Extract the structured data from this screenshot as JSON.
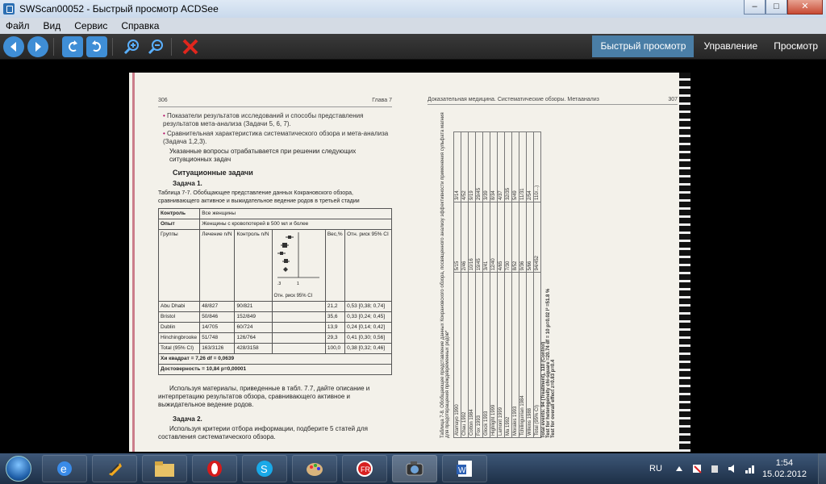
{
  "window": {
    "title": "SWScan00052 - Быстрый просмотр ACDSee"
  },
  "menu": [
    "Файл",
    "Вид",
    "Сервис",
    "Справка"
  ],
  "toolbar": {
    "buttons": [
      "back-icon",
      "forward-icon",
      "rotate-left-icon",
      "rotate-right-icon",
      "zoom-in-icon",
      "zoom-out-icon",
      "delete-icon"
    ]
  },
  "mode_tabs": [
    "Быстрый просмотр",
    "Управление",
    "Просмотр"
  ],
  "page_left": {
    "page_number": "306",
    "chapter": "Глава 7",
    "bullets": [
      "Показатели результатов исследований и способы представления результатов мета-анализа (Задачи 5, 6, 7).",
      "Сравнительная характеристика систематического обзора и мета-анализа (Задача 1,2,3)."
    ],
    "note": "Указанные вопросы отрабатывается при решении следующих ситуационных задач",
    "section_title": "Ситуационные задачи",
    "task1_title": "Задача 1.",
    "table_caption": "Таблица 7-7. Обобщающее представление данных Кокрановского обзора, сравнивающего активное и выжидательное ведение родов в третьей стадии",
    "table": {
      "control_label": "Контроль",
      "control_value": "Все женщины",
      "experience_label": "Опыт",
      "experience_value": "Женщины с кровопотерей в 500 мл и более",
      "headers": [
        "Группы",
        "Лечение n/N",
        "Контроль n/N",
        "",
        "Вес,%",
        "Отн. риск 95% CI"
      ],
      "plot_label": "Отн. риск 95% CI",
      "rows": [
        [
          "Abu Dhabi",
          "48/827",
          "90/821",
          "21,2",
          "0,53 [0,38; 0,74]"
        ],
        [
          "Bristol",
          "50/846",
          "152/849",
          "35,6",
          "0,33 [0,24; 0,45]"
        ],
        [
          "Dublin",
          "14/705",
          "60/724",
          "13,9",
          "0,24 [0,14; 0,42]"
        ],
        [
          "Hinchingbrooke",
          "51/748",
          "126/764",
          "29,3",
          "0,41 [0,30; 0,56]"
        ],
        [
          "Total (95% CI)",
          "163/3126",
          "428/3158",
          "100,0",
          "0,38 [0,32; 0,46]"
        ]
      ],
      "chi": "Хи квадрат = 7,26 df = 0,0639",
      "significance": "Достоверность = 10,84 p=0,00001"
    },
    "paragraph1": "Используя материалы, приведенные в табл. 7.7, дайте описание и интерпретацию результатов обзора, сравнивающего активное и выжидательное ведение родов.",
    "task2_title": "Задача 2.",
    "paragraph2": "Используя критерии отбора информации, подберите 5 статей для составления систематического обзора."
  },
  "page_right": {
    "header": "Доказательная медицина. Систематические обзоры. Метаанализ",
    "page_number": "307",
    "caption": "Таблица 7-8. Обобщающее представление данных Кокрановского обзора, посвященного анализу эффективности применения сульфата магния для предотвращения преждевременных родов*",
    "rows": [
      [
        "Atamayo 1990",
        "5/15",
        "3/14"
      ],
      [
        "Chau 1992",
        "2/46",
        "4/52"
      ],
      [
        "Cotton 1984",
        "10/16",
        "9/19"
      ],
      [
        "Fox 1993",
        "19/45",
        "29/45"
      ],
      [
        "Glock 1993",
        "3/41",
        "3/39"
      ],
      [
        "Highlight 1999",
        "12/40",
        "8/34"
      ],
      [
        "Lamont 1999",
        "4/65",
        "4/37"
      ],
      [
        "Ma 1992",
        "7/30",
        "32/35"
      ],
      [
        "Morales 1993",
        "8/52",
        "5/49"
      ],
      [
        "Tchilinguirian 1984",
        "9/36",
        "11/31"
      ],
      [
        "Wilkins 1988",
        "5/66",
        "2/54"
      ],
      [
        "Total (95% CI)",
        "94/452",
        "110/...)"
      ]
    ],
    "total_events": "Total events: 94 (Treatment), 110 (Control)",
    "heterogeneity": "Test for heterogeneity chi-square =20.74 df = 10 p=0.02 I² =51.8 %",
    "overall": "Test for overall effect z=0.83 p=0.4"
  },
  "taskbar": {
    "apps": [
      "explorer-icon",
      "ie-icon",
      "winamp-icon",
      "folder-icon",
      "opera-icon",
      "skype-icon",
      "paint-icon",
      "finereader-icon",
      "acdsee-icon",
      "word-icon"
    ],
    "active": "acdsee-icon",
    "lang": "RU",
    "time": "1:54",
    "date": "15.02.2012"
  }
}
